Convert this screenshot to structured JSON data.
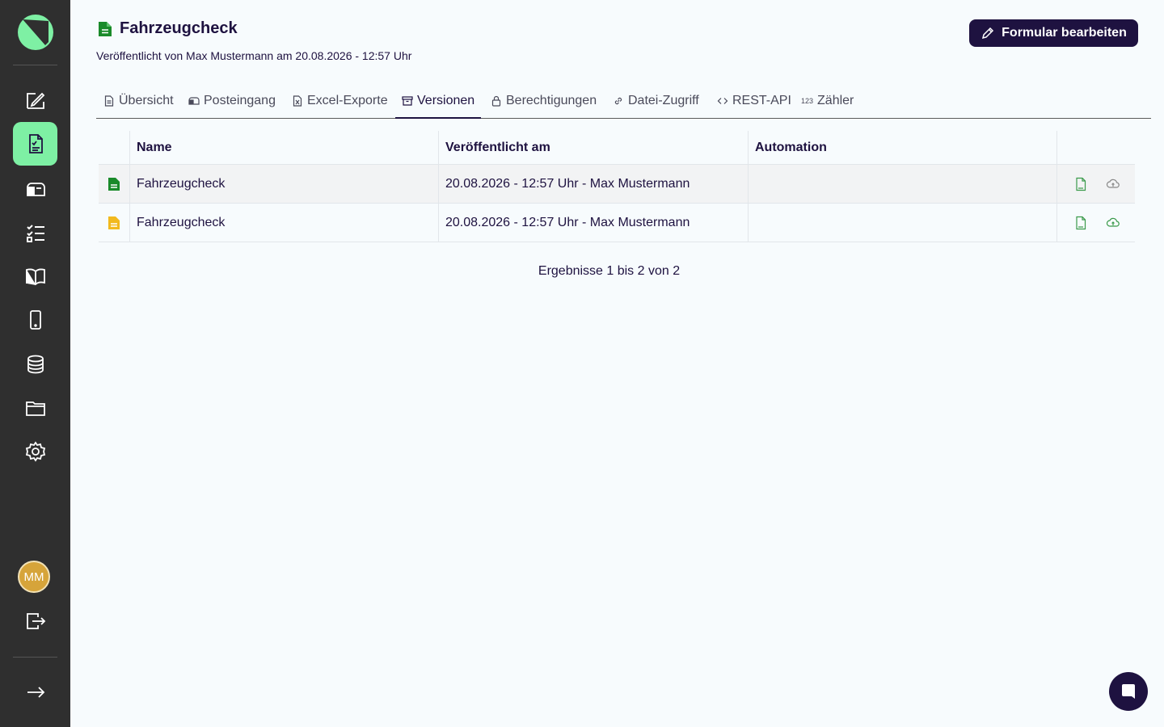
{
  "sidebar": {
    "avatar_initials": "MM",
    "icons": [
      "form-edit-icon",
      "form-document-icon",
      "inbox-icon",
      "checklist-icon",
      "book-icon",
      "mobile-icon",
      "database-icon",
      "folder-icon",
      "gear-icon",
      "logout-icon",
      "arrow-right-icon"
    ],
    "accent": "#7ef0a4"
  },
  "header": {
    "title": "Fahrzeugcheck",
    "subtitle": "Veröffentlicht von Max Mustermann am 20.08.2026 - 12:57 Uhr",
    "edit_button": "Formular bearbeiten"
  },
  "tabs": [
    {
      "label": "Übersicht",
      "icon": "document-icon"
    },
    {
      "label": "Posteingang",
      "icon": "mailbox-icon"
    },
    {
      "label": "Excel-Exporte",
      "icon": "excel-file-icon"
    },
    {
      "label": "Versionen",
      "icon": "archive-icon",
      "active": true
    },
    {
      "label": "Berechtigungen",
      "icon": "lock-icon"
    },
    {
      "label": "Datei-Zugriff",
      "icon": "link-icon"
    },
    {
      "label": "REST-API",
      "icon": "code-icon"
    },
    {
      "label": "Zähler",
      "icon": "counter-icon",
      "icon_text": "123"
    }
  ],
  "table": {
    "columns": [
      "Name",
      "Veröffentlicht am",
      "Automation"
    ],
    "rows": [
      {
        "status_color": "#1a8a2a",
        "name": "Fahrzeugcheck",
        "published": "20.08.2026 - 12:57 Uhr - Max Mustermann",
        "automation": ""
      },
      {
        "status_color": "#f2b91e",
        "name": "Fahrzeugcheck",
        "published": "20.08.2026 - 12:57 Uhr - Max Mustermann",
        "automation": ""
      }
    ]
  },
  "results": "Ergebnisse 1 bis 2 von 2",
  "colors": {
    "brand_dark": "#1e1240",
    "sidebar_bg": "#2f2f2f",
    "pdf_icon": "#3a9a4a"
  }
}
